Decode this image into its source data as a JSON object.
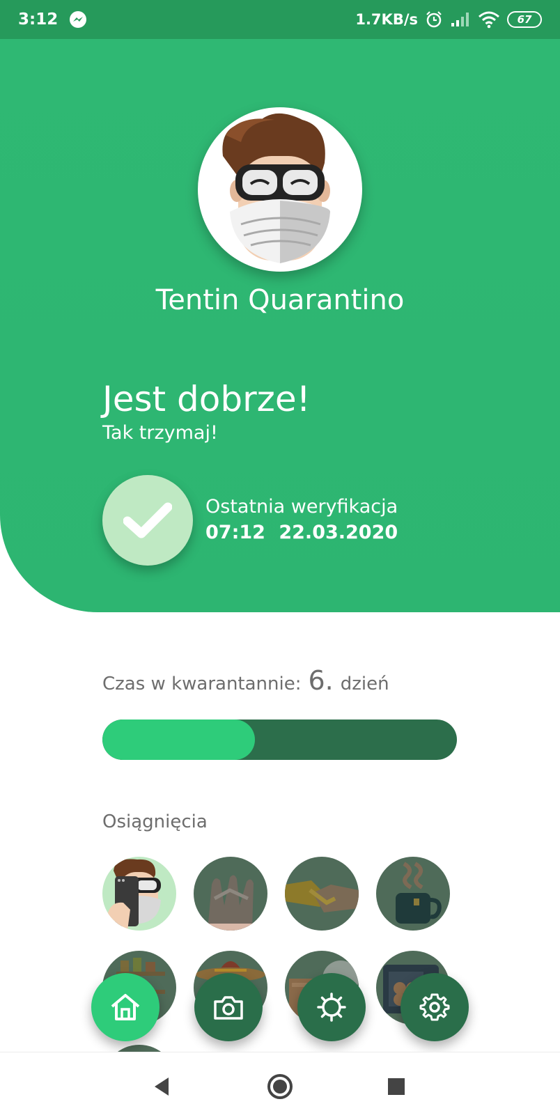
{
  "status_bar": {
    "time": "3:12",
    "net_speed": "1.7KB/s",
    "battery": "67",
    "icons": [
      "messenger-icon",
      "alarm-icon",
      "signal-icon",
      "wifi-icon",
      "battery-icon"
    ]
  },
  "profile": {
    "name": "Tentin Quarantino",
    "avatar_icon": "masked-man-avatar"
  },
  "status": {
    "title": "Jest dobrze!",
    "subtitle": "Tak trzymaj!",
    "check_icon": "checkmark-icon",
    "last_verification_label": "Ostatnia weryfikacja",
    "last_verification_time": "07:12",
    "last_verification_date": "22.03.2020"
  },
  "quarantine": {
    "label": "Czas w kwarantannie:",
    "day": "6.",
    "unit": "dzień",
    "progress_fraction": 0.43
  },
  "achievements": {
    "title": "Osiągnięcia",
    "items": [
      {
        "name": "selfie-achievement",
        "unlocked": true
      },
      {
        "name": "handwash-achievement",
        "unlocked": false
      },
      {
        "name": "handshake-achievement",
        "unlocked": false
      },
      {
        "name": "tea-achievement",
        "unlocked": false
      },
      {
        "name": "pantry-achievement",
        "unlocked": false
      },
      {
        "name": "sombrero-achievement",
        "unlocked": false
      },
      {
        "name": "boxes-achievement",
        "unlocked": false
      },
      {
        "name": "microwave-achievement",
        "unlocked": false
      }
    ]
  },
  "nav": {
    "items": [
      "home-icon",
      "camera-icon",
      "virus-icon",
      "settings-gear-icon"
    ],
    "active": "home-icon"
  },
  "system_nav": [
    "back-icon",
    "home-circle-icon",
    "recents-icon"
  ],
  "colors": {
    "primary_green": "#2fb873",
    "dark_green": "#2a6e4a",
    "accent_green": "#2ecc7a",
    "light_green": "#bfe9c3",
    "status_bar": "#269a5b"
  }
}
